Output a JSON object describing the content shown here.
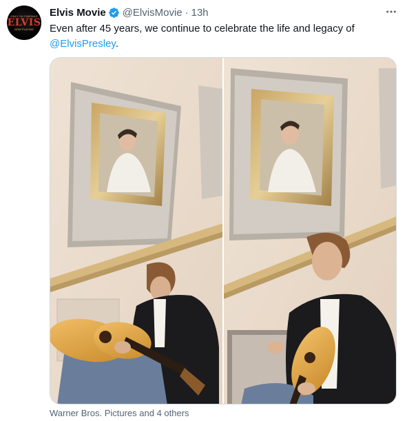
{
  "tweet": {
    "author_name": "Elvis Movie",
    "handle": "@ElvisMovie",
    "separator": "·",
    "time": "13h",
    "text_before": "Even after 45 years, we continue to celebrate the life and legacy of ",
    "mention": "@ElvisPresley",
    "text_after": ".",
    "media_credit": "Warner Bros. Pictures and 4 others"
  },
  "avatar": {
    "top_text": "ONLY IN CINEMAS",
    "title": "ELVIS",
    "bottom_text": "NOW PLAYING"
  },
  "colors": {
    "link": "#1d9bf0",
    "verified": "#1d9bf0",
    "secondary_text": "#536471"
  }
}
